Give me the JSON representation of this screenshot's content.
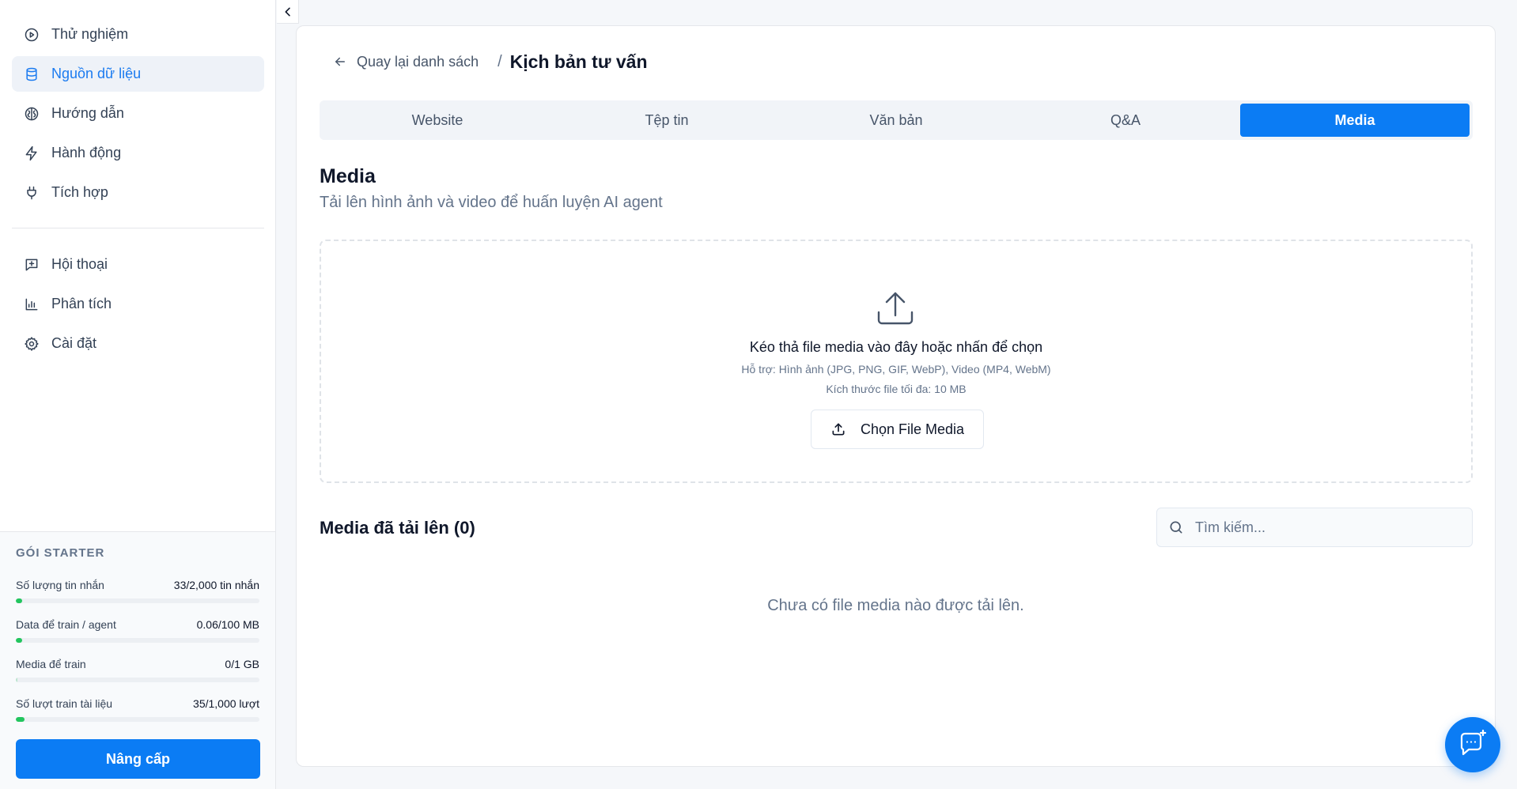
{
  "sidebar": {
    "nav": [
      {
        "label": "Thử nghiệm",
        "icon": "play-circle-icon",
        "active": false
      },
      {
        "label": "Nguồn dữ liệu",
        "icon": "database-icon",
        "active": true
      },
      {
        "label": "Hướng dẫn",
        "icon": "brain-icon",
        "active": false
      },
      {
        "label": "Hành động",
        "icon": "lightning-icon",
        "active": false
      },
      {
        "label": "Tích hợp",
        "icon": "plug-icon",
        "active": false
      }
    ],
    "nav2": [
      {
        "label": "Hội thoại",
        "icon": "chat-plus-icon"
      },
      {
        "label": "Phân tích",
        "icon": "bar-chart-icon"
      },
      {
        "label": "Cài đặt",
        "icon": "gear-icon"
      }
    ],
    "plan": {
      "title": "GÓI STARTER",
      "usage": [
        {
          "label": "Số lượng tin nhắn",
          "value": "33/2,000 tin nhắn",
          "percent": 1.65
        },
        {
          "label": "Data để train / agent",
          "value": "0.06/100 MB",
          "percent": 0.06
        },
        {
          "label": "Media để train",
          "value": "0/1 GB",
          "percent": 0
        },
        {
          "label": "Số lượt train tài liệu",
          "value": "35/1,000 lượt",
          "percent": 3.5
        }
      ],
      "upgrade_label": "Nâng cấp"
    }
  },
  "breadcrumb": {
    "back_label": "Quay lại danh sách",
    "separator": "/",
    "current": "Kịch bản tư vấn"
  },
  "tabs": [
    {
      "label": "Website",
      "active": false
    },
    {
      "label": "Tệp tin",
      "active": false
    },
    {
      "label": "Văn bản",
      "active": false
    },
    {
      "label": "Q&A",
      "active": false
    },
    {
      "label": "Media",
      "active": true
    }
  ],
  "section": {
    "title": "Media",
    "subtitle": "Tải lên hình ảnh và video để huấn luyện AI agent"
  },
  "dropzone": {
    "title": "Kéo thả file media vào đây hoặc nhấn để chọn",
    "hint_formats": "Hỗ trợ: Hình ảnh (JPG, PNG, GIF, WebP), Video (MP4, WebM)",
    "hint_size": "Kích thước file tối đa: 10 MB",
    "button_label": "Chọn File Media"
  },
  "uploaded": {
    "title": "Media đã tải lên (0)",
    "search_placeholder": "Tìm kiếm...",
    "empty_message": "Chưa có file media nào được tải lên."
  },
  "colors": {
    "accent": "#0b7cf4",
    "progress": "#22c55e"
  }
}
